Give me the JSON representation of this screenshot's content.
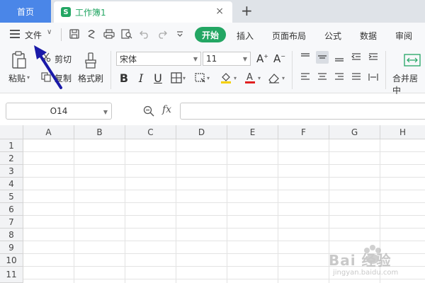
{
  "tabs": {
    "home_label": "首页",
    "doc_badge": "S",
    "doc_title": "工作簿1",
    "close_glyph": "×",
    "add_glyph": "+"
  },
  "menu": {
    "file_label": "文件",
    "active_tab": "开始",
    "tabs": [
      "插入",
      "页面布局",
      "公式",
      "数据",
      "审阅"
    ]
  },
  "ribbon": {
    "paste_label": "粘贴",
    "cut_label": "剪切",
    "copy_label": "复制",
    "format_painter_label": "格式刷",
    "font_name": "宋体",
    "font_size": "11",
    "bold": "B",
    "italic": "I",
    "underline": "U",
    "merge_center_label": "合并居中"
  },
  "formula_bar": {
    "name_box_value": "O14",
    "fx_label": "fx",
    "formula_value": ""
  },
  "grid": {
    "columns": [
      "A",
      "B",
      "C",
      "D",
      "E",
      "F",
      "G",
      "H"
    ],
    "rows": [
      "1",
      "2",
      "3",
      "4",
      "5",
      "6",
      "7",
      "8",
      "9",
      "10",
      "11"
    ]
  },
  "colors": {
    "accent_green": "#23a663",
    "home_tab_blue": "#4a86e8",
    "annotation_arrow": "#1a1aa8"
  },
  "watermark": {
    "brand": "Bai 经验",
    "url": "jingyan.baidu.com"
  }
}
